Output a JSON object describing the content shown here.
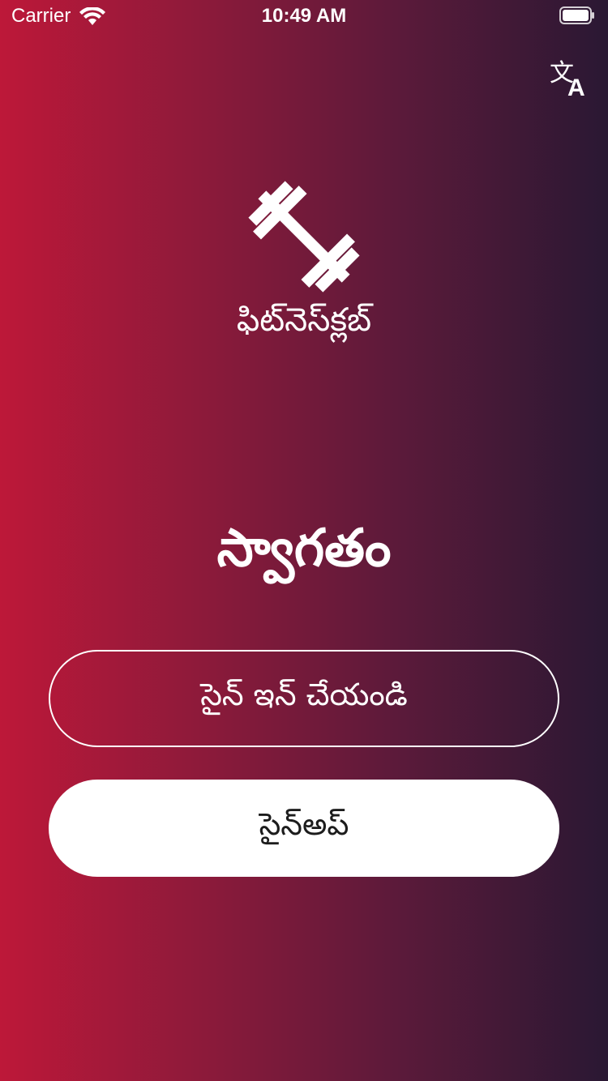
{
  "status_bar": {
    "carrier": "Carrier",
    "time": "10:49 AM"
  },
  "icons": {
    "translate": "translate-icon",
    "logo": "dumbbell-icon",
    "wifi": "wifi-icon",
    "battery": "battery-icon"
  },
  "app": {
    "name": "ఫిట్‌నెస్‌క్లబ్"
  },
  "welcome": {
    "title": "స్వాగతం"
  },
  "buttons": {
    "sign_in": "సైన్ ఇన్ చేయండి",
    "sign_up": "సైన్‌అప్"
  },
  "colors": {
    "gradient_start": "#bd1839",
    "gradient_end": "#2a1833",
    "button_fill": "#ffffff",
    "text": "#ffffff"
  }
}
